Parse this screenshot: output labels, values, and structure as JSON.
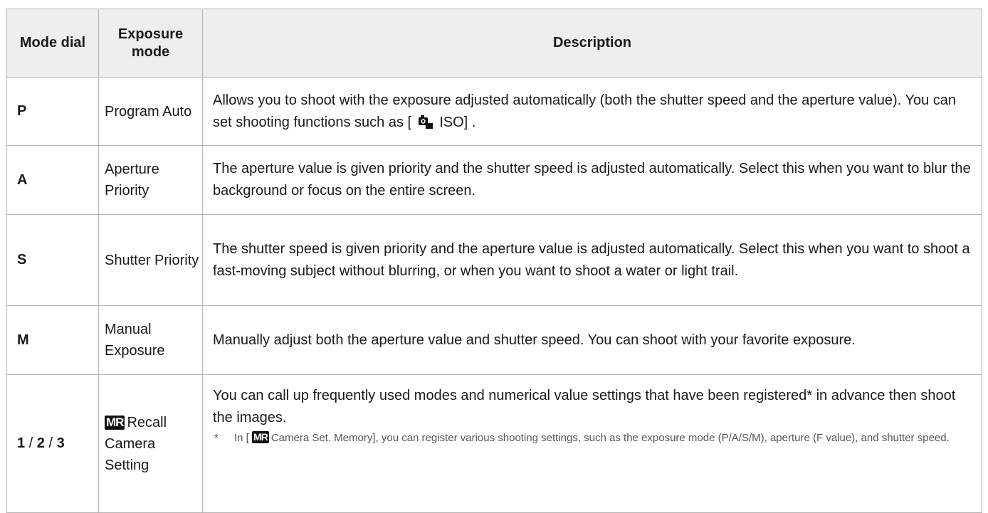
{
  "headers": {
    "mode_dial": "Mode dial",
    "exposure_mode": "Exposure mode",
    "description": "Description"
  },
  "rows": [
    {
      "dial": "P",
      "mode": "Program Auto",
      "desc_pre": "Allows you to shoot with the exposure adjusted automatically (both the shutter speed and the aperture value). You can set shooting functions such as [",
      "desc_icon": "camera-iso-icon",
      "desc_post": "ISO] ."
    },
    {
      "dial": "A",
      "mode": "Aperture Priority",
      "desc": "The aperture value is given priority and the shutter speed is adjusted automatically. Select this when you want to blur the background or focus on the entire screen."
    },
    {
      "dial": "S",
      "mode": "Shutter Priority",
      "desc": "The shutter speed is given priority and the aperture value is adjusted automatically. Select this when you want to shoot a fast-moving subject without blurring, or when you want to shoot a water or light trail."
    },
    {
      "dial": "M",
      "mode": "Manual Exposure",
      "desc": "Manually adjust both the aperture value and shutter speed. You can shoot with your favorite exposure."
    },
    {
      "dial_1": "1",
      "dial_sep1": " / ",
      "dial_2": "2",
      "dial_sep2": " / ",
      "dial_3": "3",
      "mode_badge": "MR",
      "mode": "Recall Camera Setting",
      "desc": "You can call up frequently used modes and numerical value settings that have been registered* in advance then shoot the images.",
      "footnote_mark": "*",
      "footnote_pre": "In [",
      "footnote_badge": "MR",
      "footnote_post": "Camera Set. Memory], you can register various shooting settings, such as the exposure mode (P/A/S/M), aperture (F value), and shutter speed."
    }
  ],
  "colors": {
    "header_bg": "#eeeeee",
    "border": "#b4b4b4",
    "text": "#1a1a1a",
    "footnote_text": "#555555",
    "badge_bg": "#111111"
  }
}
